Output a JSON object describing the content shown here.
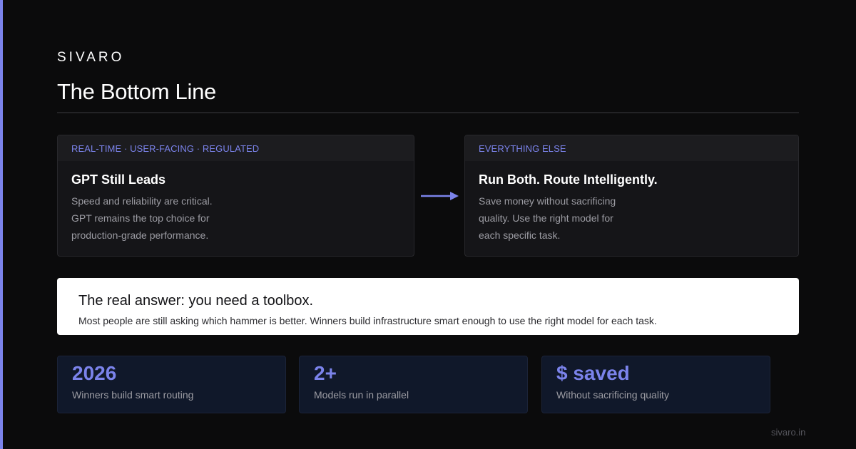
{
  "brand": "SIVARO",
  "title": "The Bottom Line",
  "colors": {
    "accent": "#7b83eb",
    "background": "#0b0b0c",
    "card": "#151518",
    "stat_card": "#10182a"
  },
  "comparison": {
    "left": {
      "tag": "REAL-TIME · USER-FACING · REGULATED",
      "heading": "GPT Still Leads",
      "body_lines": [
        "Speed and reliability are critical.",
        "GPT remains the top choice for",
        "production-grade performance."
      ]
    },
    "arrow_icon": "arrow-right-icon",
    "right": {
      "tag": "EVERYTHING ELSE",
      "heading": "Run Both. Route Intelligently.",
      "body_lines": [
        "Save money without sacrificing",
        "quality. Use the right model for",
        "each specific task."
      ]
    }
  },
  "answer": {
    "title": "The real answer: you need a toolbox.",
    "body": "Most people are still asking which hammer is better. Winners build infrastructure smart enough to use the right model for each task."
  },
  "stats": [
    {
      "value": "2026",
      "label": "Winners build smart routing"
    },
    {
      "value": "2+",
      "label": "Models run in parallel"
    },
    {
      "value": "$ saved",
      "label": "Without sacrificing quality"
    }
  ],
  "footer": "sivaro.in"
}
